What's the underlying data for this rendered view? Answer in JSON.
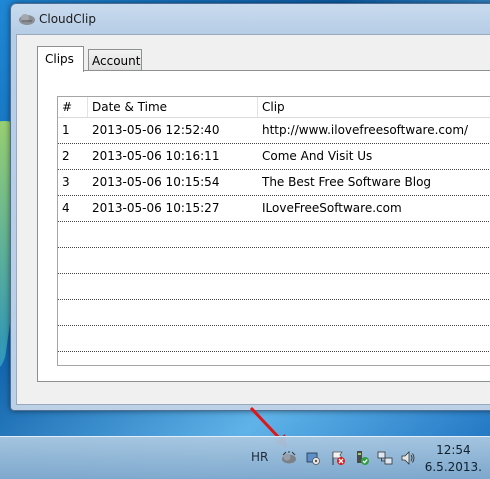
{
  "window": {
    "title": "CloudClip"
  },
  "tabs": [
    {
      "label": "Clips",
      "active": true
    },
    {
      "label": "Account",
      "active": false
    }
  ],
  "grid": {
    "columns": [
      "#",
      "Date & Time",
      "Clip"
    ],
    "rows": [
      {
        "num": "1",
        "datetime": "2013-05-06 12:52:40",
        "clip": "http://www.ilovefreesoftware.com/"
      },
      {
        "num": "2",
        "datetime": "2013-05-06 10:16:11",
        "clip": "Come And Visit Us"
      },
      {
        "num": "3",
        "datetime": "2013-05-06 10:15:54",
        "clip": "The Best Free Software Blog"
      },
      {
        "num": "4",
        "datetime": "2013-05-06 10:15:27",
        "clip": "ILoveFreeSoftware.com"
      }
    ]
  },
  "taskbar": {
    "language": "HR",
    "time": "12:54",
    "date": "6.5.2013.",
    "tray_icons": [
      "cloudclip-icon",
      "network-tool-icon",
      "action-center-flag-icon",
      "security-shield-icon",
      "network-icon",
      "volume-icon"
    ]
  },
  "colors": {
    "annotation_arrow": "#e01515",
    "taskbar": "#9dbcd8",
    "window_frame": "#bcd0e6"
  }
}
